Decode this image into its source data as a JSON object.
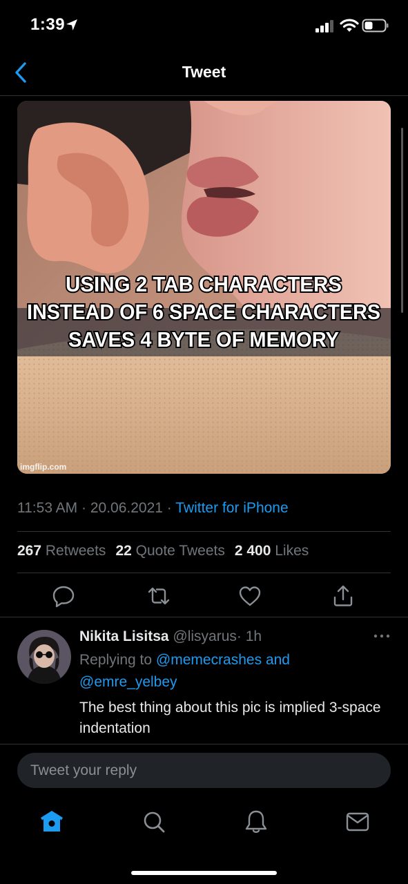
{
  "status_bar": {
    "time": "1:39"
  },
  "header": {
    "title": "Tweet"
  },
  "media": {
    "caption_lines": [
      "USING 2 TAB CHARACTERS",
      "INSTEAD OF 6 SPACE CHARACTERS",
      "SAVES 4 BYTE OF MEMORY"
    ],
    "watermark": "imgflip.com"
  },
  "tweet_meta": {
    "time": "11:53 AM",
    "separator": " · ",
    "date": "20.06.2021",
    "source": "Twitter for iPhone"
  },
  "stats": {
    "retweets_count": "267",
    "retweets_label": "Retweets",
    "quotes_count": "22",
    "quotes_label": "Quote Tweets",
    "likes_count": "2 400",
    "likes_label": "Likes"
  },
  "actions": {
    "icons": [
      "reply-icon",
      "retweet-icon",
      "like-icon",
      "share-icon"
    ]
  },
  "reply": {
    "name": "Nikita Lisitsa",
    "handle": "@lisyarus",
    "time": "· 1h",
    "replying_prefix": "Replying to",
    "mention_1": "@memecrashes",
    "and": "and",
    "mention_2": "@emre_yelbey",
    "text": "The best thing about this pic is implied 3-space indentation"
  },
  "composer": {
    "placeholder": "Tweet your reply"
  },
  "tab_bar": {
    "items": [
      "home-icon",
      "search-icon",
      "notifications-icon",
      "messages-icon"
    ]
  },
  "colors": {
    "accent": "#1d9bf0",
    "secondary_text": "#71767b",
    "background": "#000000"
  }
}
